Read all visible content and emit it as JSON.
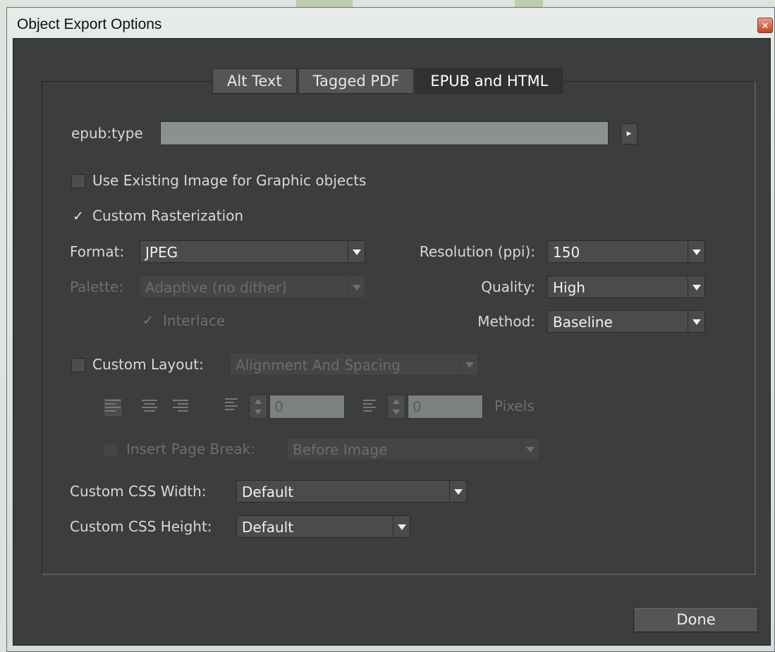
{
  "window": {
    "title": "Object Export Options",
    "close_glyph": "×"
  },
  "tabs": [
    {
      "label": "Alt Text",
      "active": false
    },
    {
      "label": "Tagged PDF",
      "active": false
    },
    {
      "label": "EPUB and HTML",
      "active": true
    }
  ],
  "epub": {
    "label": "epub:type",
    "value": "",
    "menu_glyph": "▸"
  },
  "use_existing": {
    "label": "Use Existing Image for Graphic objects",
    "checked": false
  },
  "custom_rasterization": {
    "label": "Custom Rasterization",
    "checked": true,
    "check_glyph": "✓"
  },
  "format": {
    "label": "Format:",
    "value": "JPEG"
  },
  "palette": {
    "label": "Palette:",
    "value": "Adaptive (no dither)"
  },
  "interlace": {
    "label": "Interlace",
    "check_glyph": "✓"
  },
  "resolution": {
    "label": "Resolution (ppi):",
    "value": "150"
  },
  "quality": {
    "label": "Quality:",
    "value": "High"
  },
  "method": {
    "label": "Method:",
    "value": "Baseline"
  },
  "custom_layout": {
    "label": "Custom Layout:",
    "value": "Alignment And Spacing",
    "checked": false
  },
  "spacing": {
    "before_value": "0",
    "after_value": "0",
    "unit": "Pixels"
  },
  "page_break": {
    "label": "Insert Page Break:",
    "value": "Before Image"
  },
  "css_width": {
    "label": "Custom CSS Width:",
    "value": "Default"
  },
  "css_height": {
    "label": "Custom CSS Height:",
    "value": "Default"
  },
  "done": {
    "label": "Done"
  },
  "colors": {
    "panel": "#3c3d3d",
    "field": "#8c9190",
    "control": "#4a4b4b"
  }
}
